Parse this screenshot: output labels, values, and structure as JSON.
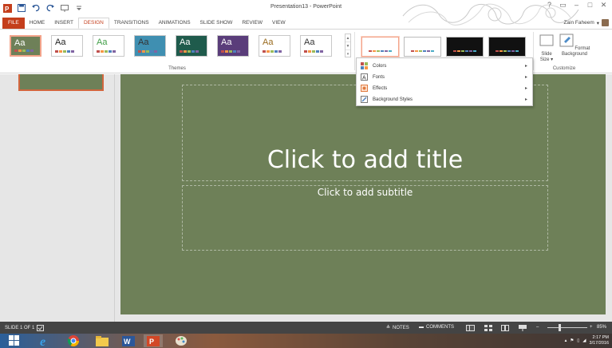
{
  "window": {
    "title": "Presentation13 - PowerPoint",
    "user_name": "Zain Faheem"
  },
  "ribbon_tabs": [
    "FILE",
    "HOME",
    "INSERT",
    "DESIGN",
    "TRANSITIONS",
    "ANIMATIONS",
    "SLIDE SHOW",
    "REVIEW",
    "VIEW"
  ],
  "active_tab": "DESIGN",
  "themes": {
    "group_label": "Themes",
    "thumb_text": "Aa",
    "gallery": [
      {
        "bg": "#6e8058",
        "fg": "#ffffff",
        "selected": true
      },
      {
        "bg": "#ffffff",
        "fg": "#222222"
      },
      {
        "bg": "#ffffff",
        "fg": "#44a04a"
      },
      {
        "bg": "#3f8fb1",
        "fg": "#333333"
      },
      {
        "bg": "#1f5b4c",
        "fg": "#ffffff"
      },
      {
        "bg": "#5a3d7a",
        "fg": "#ffffff"
      },
      {
        "bg": "#ffffff",
        "fg": "#9a6b1f"
      },
      {
        "bg": "#ffffff",
        "fg": "#333333"
      }
    ]
  },
  "variants": [
    {
      "bg": "#ffffff",
      "selected": true
    },
    {
      "bg": "#ffffff"
    },
    {
      "bg": "#111111"
    },
    {
      "bg": "#111111"
    }
  ],
  "customize": {
    "group_label": "Customize",
    "slide_size_label": "Slide Size",
    "format_background_label": "Format Background"
  },
  "variant_menu": {
    "items": [
      {
        "label": "Colors",
        "icon": "colors-icon"
      },
      {
        "label": "Fonts",
        "icon": "fonts-icon"
      },
      {
        "label": "Effects",
        "icon": "effects-icon"
      },
      {
        "label": "Background Styles",
        "icon": "background-styles-icon"
      }
    ]
  },
  "slide": {
    "title_placeholder": "Click to add title",
    "subtitle_placeholder": "Click to add subtitle",
    "background": "#6e8058"
  },
  "status_bar": {
    "slide_indicator": "SLIDE 1 OF 1",
    "notes_label": "NOTES",
    "comments_label": "COMMENTS",
    "zoom_level": "85%",
    "zoom_fraction": 0.3
  },
  "taskbar": {
    "time": "2:17 PM",
    "date": "3/17/2016",
    "apps": [
      "start",
      "internet-explorer",
      "chrome",
      "file-explorer",
      "word",
      "powerpoint",
      "paint"
    ]
  },
  "colors": {
    "accent": "#c43e1c",
    "slide_bg": "#6e8058"
  }
}
